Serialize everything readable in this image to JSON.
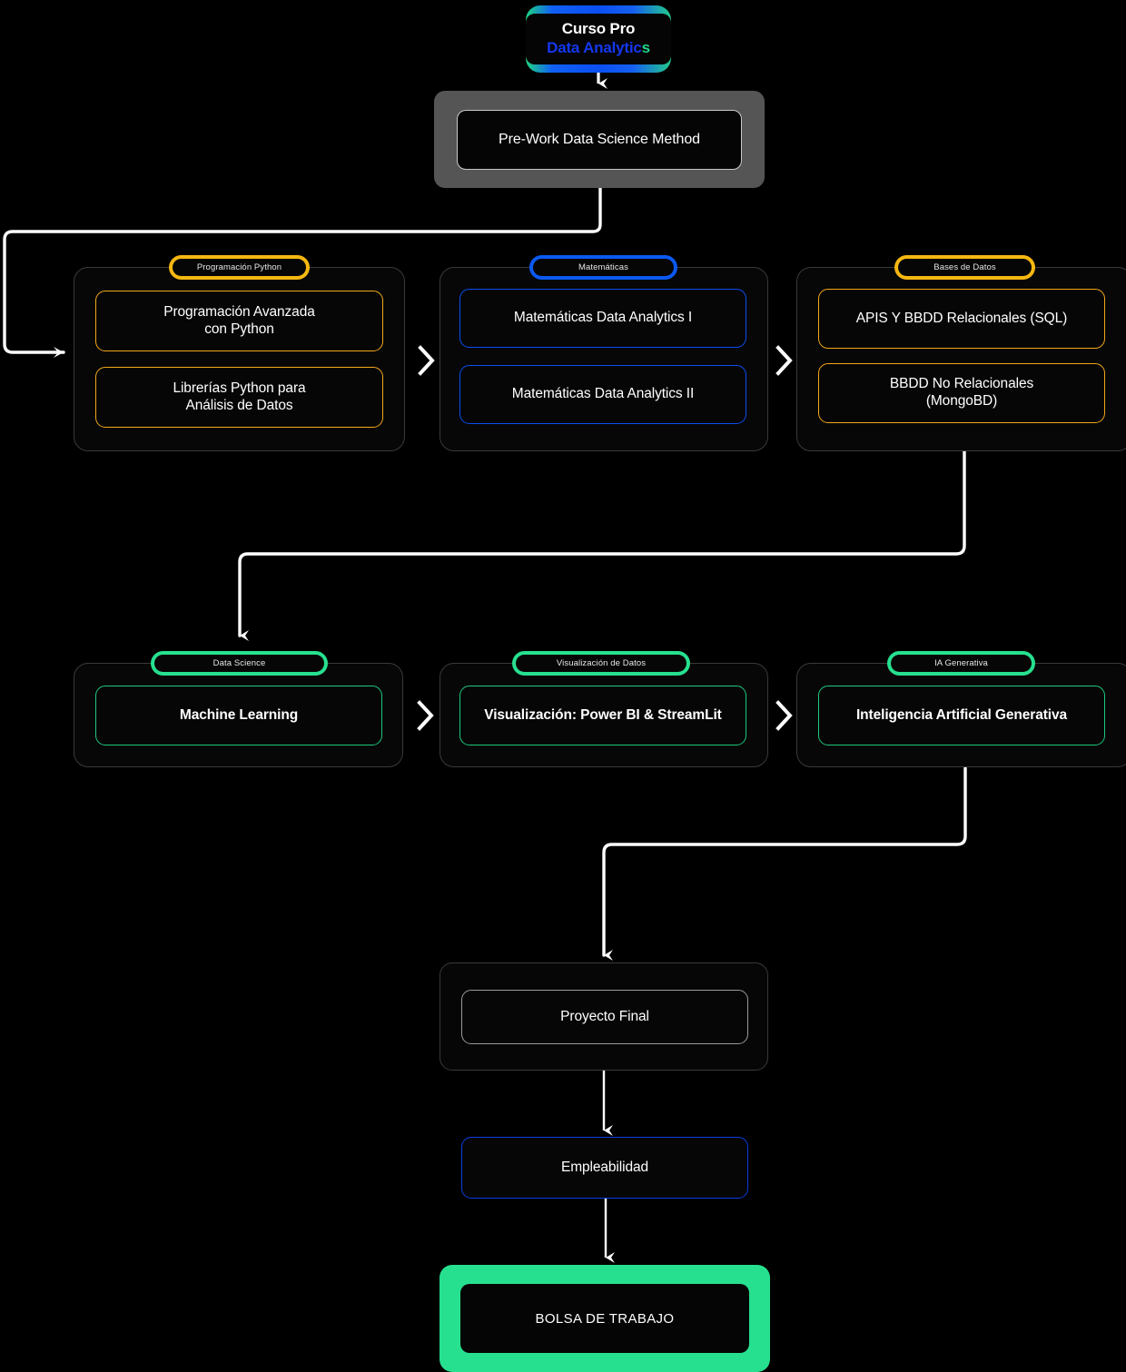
{
  "hero": {
    "line1": "Curso Pro",
    "line2_main": "Data Analytic",
    "line2_tail": "s",
    "gradient_start": "#1fd67f",
    "gradient_mid": "#0b4ff2",
    "gradient_end": "#22c98b"
  },
  "prework": {
    "label": "Pre-Work Data Science Method",
    "frame_color": "#555555"
  },
  "row1": {
    "columns": [
      {
        "badge": "Programación Python",
        "accent": "#f6b711",
        "cards": [
          "Programación Avanzada\ncon Python",
          "Librerías Python para\nAnálisis de Datos"
        ],
        "card1_line1": "Programación Avanzada",
        "card1_line2": "con Python",
        "card2_line1": "Librerías Python para",
        "card2_line2": "Análisis de Datos"
      },
      {
        "badge": "Matemáticas",
        "accent": "#0b59f0",
        "card1_line1": "Matemáticas Data Analytics I",
        "card1_line2": "",
        "card2_line1": "Matemáticas Data Analytics II",
        "card2_line2": ""
      },
      {
        "badge": "Bases de Datos",
        "accent": "#f6b711",
        "card1_line1": "APIS Y BBDD Relacionales (SQL)",
        "card1_line2": "",
        "card2_line1": "BBDD No Relacionales",
        "card2_line2": "(MongoBD)"
      }
    ]
  },
  "row2": {
    "columns": [
      {
        "badge": "Data Science",
        "accent": "#27e08f",
        "card": "Machine Learning"
      },
      {
        "badge": "Visualización de Datos",
        "accent": "#27e08f",
        "card": "Visualización: Power BI & StreamLit"
      },
      {
        "badge": "IA Generativa",
        "accent": "#27e08f",
        "card": "Inteligencia Artificial Generativa"
      }
    ]
  },
  "final": {
    "proyecto": "Proyecto Final",
    "empleabilidad": "Empleabilidad",
    "bolsa": "BOLSA DE TRABAJO",
    "bolsa_color": "#27e08f",
    "empleabilidad_color": "#0b3ce0"
  },
  "icons": {
    "chevron": "chevron-right-icon",
    "arrow": "arrow-down-icon"
  }
}
